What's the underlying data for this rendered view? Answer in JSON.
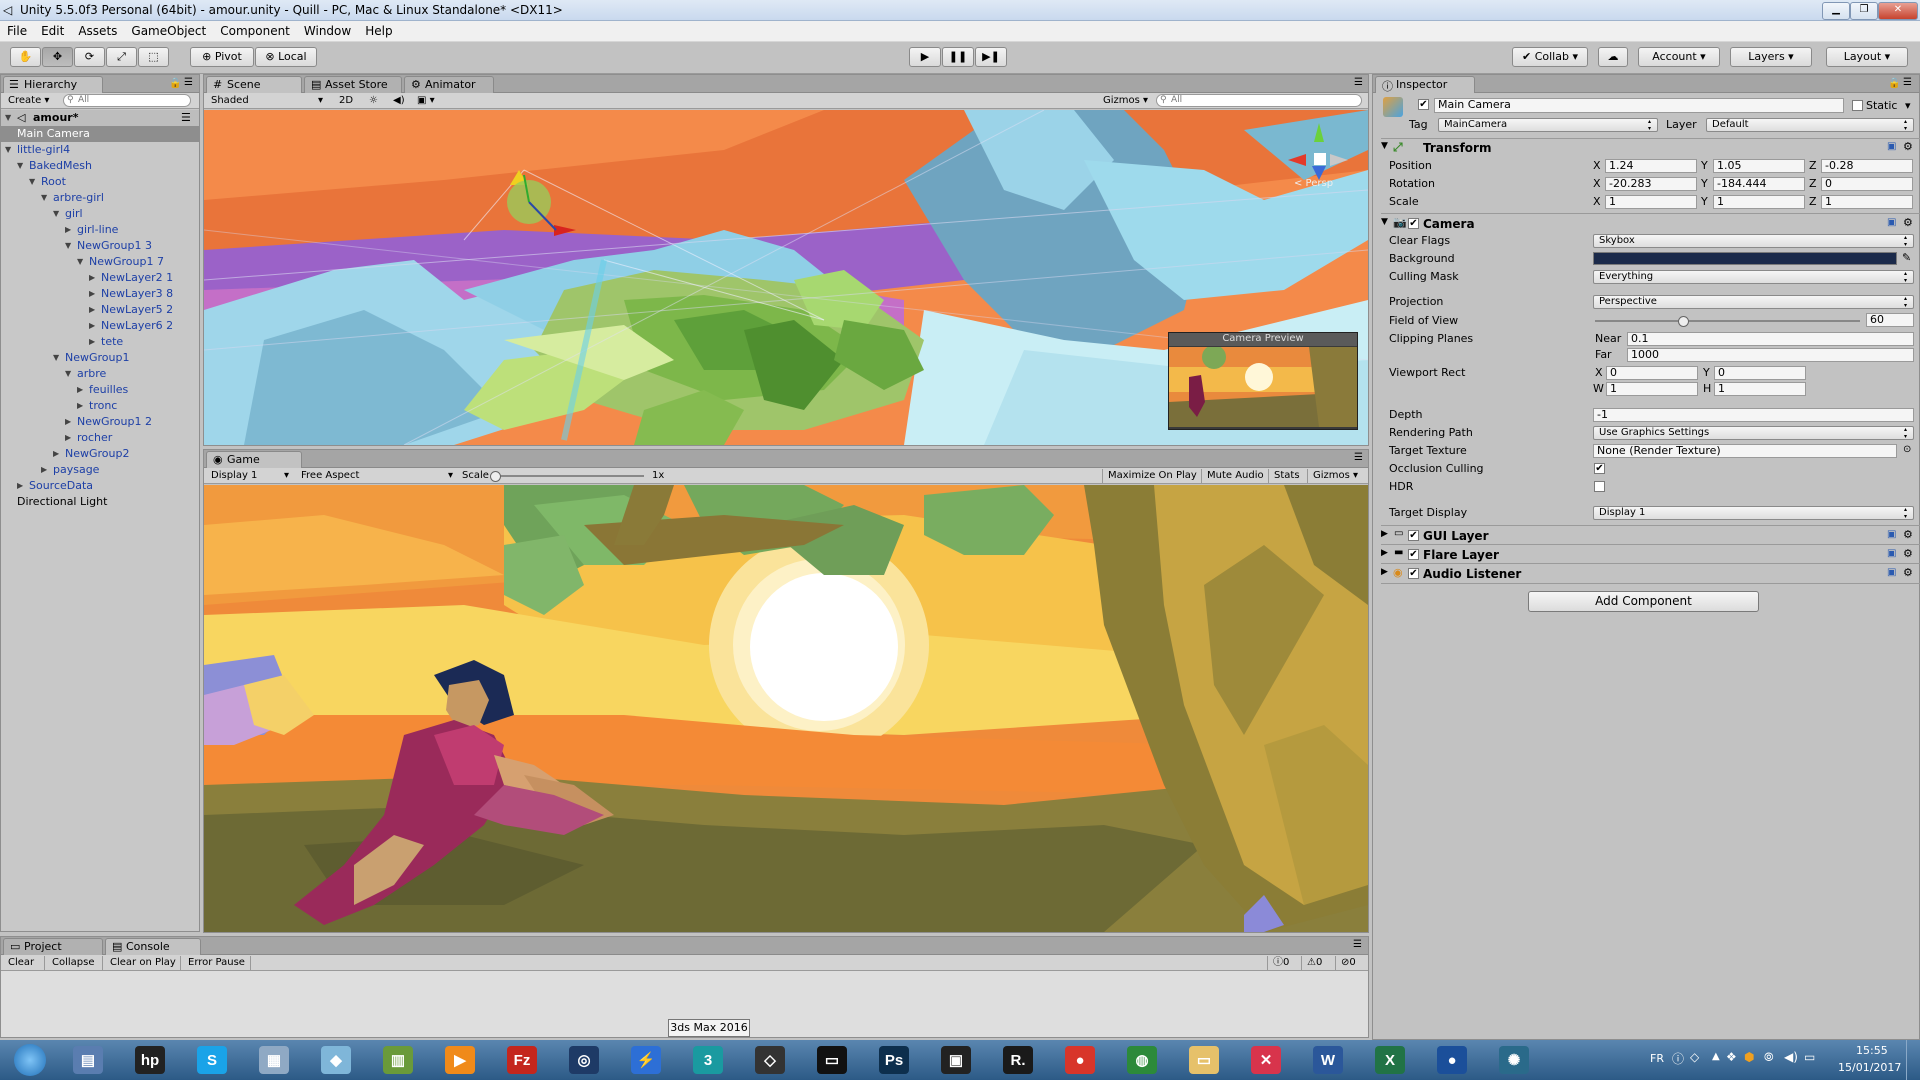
{
  "window": {
    "title": "Unity 5.5.0f3 Personal (64bit) - amour.unity - Quill - PC, Mac & Linux Standalone* <DX11>"
  },
  "menu": [
    "File",
    "Edit",
    "Assets",
    "GameObject",
    "Component",
    "Window",
    "Help"
  ],
  "toolbar": {
    "pivot_label": "Pivot",
    "local_label": "Local",
    "collab_label": "Collab",
    "account_label": "Account",
    "layers_label": "Layers",
    "layout_label": "Layout"
  },
  "hierarchy": {
    "tab": "Hierarchy",
    "create_label": "Create",
    "search_placeholder": "All",
    "scene_name": "amour*",
    "items": [
      {
        "label": "Main Camera",
        "depth": 1,
        "arrow": "",
        "selected": true,
        "prefab": false
      },
      {
        "label": "little-girl4",
        "depth": 1,
        "arrow": "open",
        "selected": false,
        "prefab": true
      },
      {
        "label": "BakedMesh",
        "depth": 2,
        "arrow": "open",
        "selected": false,
        "prefab": true
      },
      {
        "label": "Root",
        "depth": 3,
        "arrow": "open",
        "selected": false,
        "prefab": true
      },
      {
        "label": "arbre-girl",
        "depth": 4,
        "arrow": "open",
        "selected": false,
        "prefab": true
      },
      {
        "label": "girl",
        "depth": 5,
        "arrow": "open",
        "selected": false,
        "prefab": true
      },
      {
        "label": "girl-line",
        "depth": 6,
        "arrow": "closed",
        "selected": false,
        "prefab": true
      },
      {
        "label": "NewGroup1 3",
        "depth": 6,
        "arrow": "open",
        "selected": false,
        "prefab": true
      },
      {
        "label": "NewGroup1 7",
        "depth": 7,
        "arrow": "open",
        "selected": false,
        "prefab": true
      },
      {
        "label": "NewLayer2 1",
        "depth": 8,
        "arrow": "closed",
        "selected": false,
        "prefab": true
      },
      {
        "label": "NewLayer3 8",
        "depth": 8,
        "arrow": "closed",
        "selected": false,
        "prefab": true
      },
      {
        "label": "NewLayer5 2",
        "depth": 8,
        "arrow": "closed",
        "selected": false,
        "prefab": true
      },
      {
        "label": "NewLayer6 2",
        "depth": 8,
        "arrow": "closed",
        "selected": false,
        "prefab": true
      },
      {
        "label": "tete",
        "depth": 8,
        "arrow": "closed",
        "selected": false,
        "prefab": true
      },
      {
        "label": "NewGroup1",
        "depth": 5,
        "arrow": "open",
        "selected": false,
        "prefab": true
      },
      {
        "label": "arbre",
        "depth": 6,
        "arrow": "open",
        "selected": false,
        "prefab": true
      },
      {
        "label": "feuilles",
        "depth": 7,
        "arrow": "closed",
        "selected": false,
        "prefab": true
      },
      {
        "label": "tronc",
        "depth": 7,
        "arrow": "closed",
        "selected": false,
        "prefab": true
      },
      {
        "label": "NewGroup1 2",
        "depth": 6,
        "arrow": "closed",
        "selected": false,
        "prefab": true
      },
      {
        "label": "rocher",
        "depth": 6,
        "arrow": "closed",
        "selected": false,
        "prefab": true
      },
      {
        "label": "NewGroup2",
        "depth": 5,
        "arrow": "closed",
        "selected": false,
        "prefab": true
      },
      {
        "label": "paysage",
        "depth": 4,
        "arrow": "closed",
        "selected": false,
        "prefab": true
      },
      {
        "label": "SourceData",
        "depth": 2,
        "arrow": "closed",
        "selected": false,
        "prefab": true
      },
      {
        "label": "Directional Light",
        "depth": 1,
        "arrow": "",
        "selected": false,
        "prefab": false
      }
    ]
  },
  "scene": {
    "tabs": [
      "Scene",
      "Asset Store",
      "Animator"
    ],
    "shading": "Shaded",
    "mode_2d": "2D",
    "gizmos_label": "Gizmos",
    "search_placeholder": "All",
    "gizmo_label": "< Persp",
    "camera_preview_title": "Camera Preview"
  },
  "game": {
    "tab": "Game",
    "display": "Display 1",
    "aspect": "Free Aspect",
    "scale_label": "Scale",
    "scale_value": "1x",
    "maximize_label": "Maximize On Play",
    "mute_label": "Mute Audio",
    "stats_label": "Stats",
    "gizmos_label": "Gizmos"
  },
  "bottom": {
    "tabs": [
      "Project",
      "Console"
    ],
    "buttons": [
      "Clear",
      "Collapse",
      "Clear on Play",
      "Error Pause"
    ],
    "counts": {
      "info": "0",
      "warn": "0",
      "error": "0"
    }
  },
  "inspector": {
    "tab": "Inspector",
    "object_name": "Main Camera",
    "static_label": "Static",
    "tag_label": "Tag",
    "tag_value": "MainCamera",
    "layer_label": "Layer",
    "layer_value": "Default",
    "transform": {
      "title": "Transform",
      "position_label": "Position",
      "rotation_label": "Rotation",
      "scale_label": "Scale",
      "position": {
        "x": "1.24",
        "y": "1.05",
        "z": "-0.28"
      },
      "rotation": {
        "x": "-20.283",
        "y": "-184.444",
        "z": "0"
      },
      "scale": {
        "x": "1",
        "y": "1",
        "z": "1"
      }
    },
    "camera": {
      "title": "Camera",
      "clear_flags_label": "Clear Flags",
      "clear_flags": "Skybox",
      "background_label": "Background",
      "background_color": "#1b2a4a",
      "culling_mask_label": "Culling Mask",
      "culling_mask": "Everything",
      "projection_label": "Projection",
      "projection": "Perspective",
      "fov_label": "Field of View",
      "fov": "60",
      "fov_fraction": 0.33,
      "clipping_label": "Clipping Planes",
      "near_label": "Near",
      "near": "0.1",
      "far_label": "Far",
      "far": "1000",
      "viewport_label": "Viewport Rect",
      "vp_x": "0",
      "vp_y": "0",
      "vp_w": "1",
      "vp_h": "1",
      "depth_label": "Depth",
      "depth": "-1",
      "rendering_path_label": "Rendering Path",
      "rendering_path": "Use Graphics Settings",
      "target_texture_label": "Target Texture",
      "target_texture": "None (Render Texture)",
      "occlusion_label": "Occlusion Culling",
      "hdr_label": "HDR",
      "target_display_label": "Target Display",
      "target_display": "Display 1"
    },
    "components": [
      "GUI Layer",
      "Flare Layer",
      "Audio Listener"
    ],
    "add_component_label": "Add Component"
  },
  "taskbar": {
    "tooltip": "3ds Max 2016",
    "lang": "FR",
    "time": "15:55",
    "date": "15/01/2017",
    "apps": [
      {
        "name": "start-orb",
        "glyph": "",
        "color": "#2f8be0"
      },
      {
        "name": "computer-app",
        "glyph": "▤",
        "color": "#5a7db0"
      },
      {
        "name": "hp-app",
        "glyph": "hp",
        "color": "#222222"
      },
      {
        "name": "skype-app",
        "glyph": "S",
        "color": "#1aa3e8"
      },
      {
        "name": "calculator-app",
        "glyph": "▦",
        "color": "#8fa9c4"
      },
      {
        "name": "eraser-app",
        "glyph": "◆",
        "color": "#7fb6d9"
      },
      {
        "name": "chart-app",
        "glyph": "▥",
        "color": "#6a9a3a"
      },
      {
        "name": "media-app",
        "glyph": "▶",
        "color": "#f08a1a"
      },
      {
        "name": "filezilla-app",
        "glyph": "Fz",
        "color": "#c4261d"
      },
      {
        "name": "blender-app",
        "glyph": "◎",
        "color": "#1e3a66"
      },
      {
        "name": "lightning-app",
        "glyph": "⚡",
        "color": "#2d6fd6"
      },
      {
        "name": "3dsmax-app",
        "glyph": "3",
        "color": "#1a9aa0"
      },
      {
        "name": "unity-app",
        "glyph": "◇",
        "color": "#333333"
      },
      {
        "name": "oculus-app",
        "glyph": "▭",
        "color": "#111111"
      },
      {
        "name": "photoshop-app",
        "glyph": "Ps",
        "color": "#0d2f4d"
      },
      {
        "name": "video-app",
        "glyph": "▣",
        "color": "#222222"
      },
      {
        "name": "r-app",
        "glyph": "R.",
        "color": "#1a1a1a"
      },
      {
        "name": "chrome-app",
        "glyph": "●",
        "color": "#d8352a"
      },
      {
        "name": "globe-app",
        "glyph": "◍",
        "color": "#2c8a3a"
      },
      {
        "name": "folder-app",
        "glyph": "▭",
        "color": "#e6c16a"
      },
      {
        "name": "x-app",
        "glyph": "✕",
        "color": "#d8344c"
      },
      {
        "name": "word-app",
        "glyph": "W",
        "color": "#2b579a"
      },
      {
        "name": "excel-app",
        "glyph": "X",
        "color": "#217346"
      },
      {
        "name": "earth-app",
        "glyph": "●",
        "color": "#1b4f9a"
      },
      {
        "name": "tree-app",
        "glyph": "✺",
        "color": "#2a6a8a"
      }
    ]
  }
}
